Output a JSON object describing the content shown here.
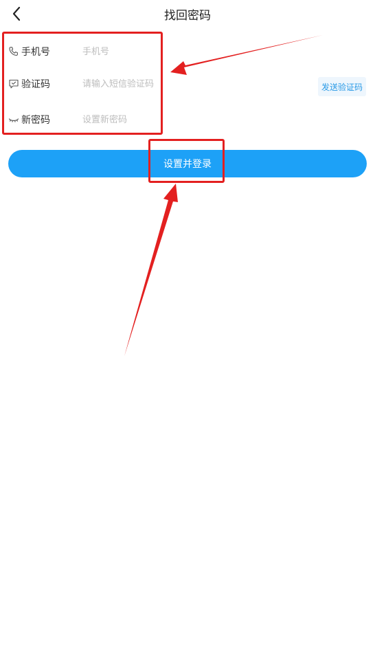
{
  "header": {
    "title": "找回密码",
    "back_icon": "chevron-left-icon"
  },
  "form": {
    "phone": {
      "label": "手机号",
      "placeholder": "手机号",
      "value": "",
      "icon": "phone-icon"
    },
    "code": {
      "label": "验证码",
      "placeholder": "请输入短信验证码",
      "value": "",
      "icon": "message-icon"
    },
    "password": {
      "label": "新密码",
      "placeholder": "设置新密码",
      "value": "",
      "icon": "eye-closed-icon"
    },
    "send_code_label": "发送验证码"
  },
  "submit_label": "设置并登录",
  "colors": {
    "primary": "#1da1f7",
    "send_code_bg": "#eef6fd",
    "send_code_text": "#2a9ae6",
    "annotation": "#e32020"
  }
}
